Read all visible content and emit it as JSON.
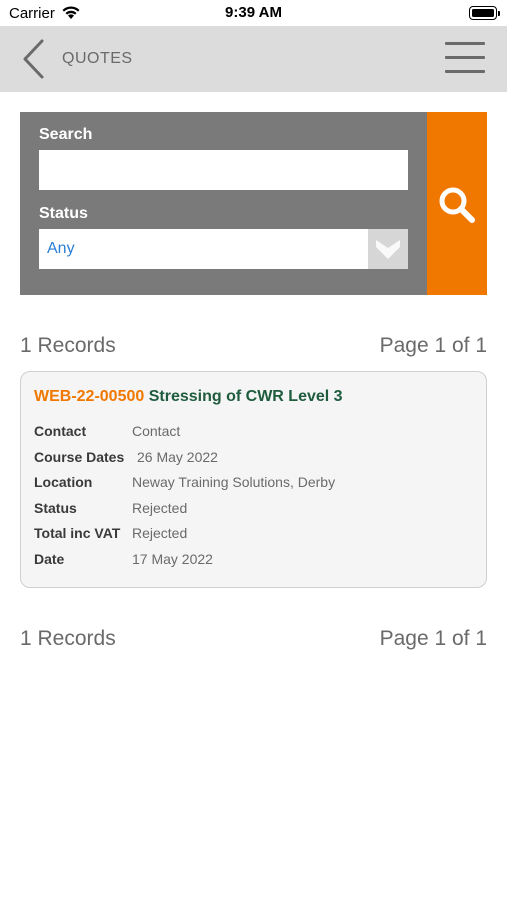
{
  "status_bar": {
    "carrier": "Carrier",
    "time": "9:39 AM",
    "icons": [
      "wifi-icon",
      "battery-icon"
    ]
  },
  "nav": {
    "title": "QUOTES",
    "back_icon": "chevron-left-icon",
    "menu_icon": "hamburger-menu-icon"
  },
  "search": {
    "search_label": "Search",
    "search_value": "",
    "status_label": "Status",
    "status_value": "Any",
    "search_button_icon": "magnifier-icon"
  },
  "results_header": {
    "records": "1 Records",
    "page": "Page 1 of 1"
  },
  "quotes": [
    {
      "ref": "WEB-22-00500",
      "course": "Stressing of CWR Level 3",
      "fields": [
        {
          "label": "Contact",
          "value": "Contact"
        },
        {
          "label": "Course Dates",
          "value": "26 May 2022"
        },
        {
          "label": "Location",
          "value": "Neway Training Solutions, Derby"
        },
        {
          "label": "Status",
          "value": "Rejected"
        },
        {
          "label": "Total inc VAT",
          "value": "Rejected"
        },
        {
          "label": "Date",
          "value": "17 May 2022"
        }
      ]
    }
  ],
  "results_footer": {
    "records": "1 Records",
    "page": "Page 1 of 1"
  },
  "colors": {
    "accent": "#f07800",
    "course_title": "#1f5c3d",
    "panel": "#7a7a7a",
    "navbar": "#dcdcdc",
    "select_value": "#2a7fd4"
  }
}
